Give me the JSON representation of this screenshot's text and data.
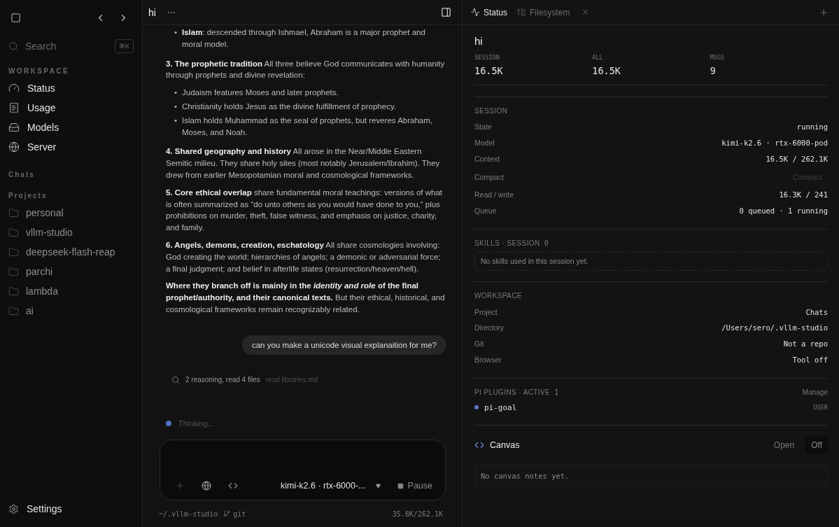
{
  "sidebar": {
    "search": {
      "placeholder": "Search",
      "shortcut": "⌘K"
    },
    "workspace_label": "WORKSPACE",
    "nav": [
      {
        "label": "Status",
        "kind": "status"
      },
      {
        "label": "Usage",
        "kind": "usage"
      },
      {
        "label": "Models",
        "kind": "models"
      },
      {
        "label": "Server",
        "kind": "server"
      }
    ],
    "chats_label": "Chats",
    "projects_label": "Projects",
    "projects": [
      "personal",
      "vllm-studio",
      "deepseek-flash-reap",
      "parchi",
      "lambda",
      "ai"
    ],
    "settings": "Settings"
  },
  "chat": {
    "title": "hi",
    "blocks": [
      {
        "kind": "list",
        "marker": "•",
        "items": [
          "**Islam**: descended through Ishmael, Abraham is a major prophet and moral model."
        ]
      },
      {
        "kind": "para",
        "text": "**3. The prophetic tradition** All three believe God communicates with humanity through prophets and divine revelation:"
      },
      {
        "kind": "list",
        "marker": "•",
        "items": [
          "Judaism features Moses and later prophets.",
          "Christianity holds Jesus as the divine fulfillment of prophecy.",
          "Islam holds Muhammad as the seal of prophets, but reveres Abraham, Moses, and Noah."
        ]
      },
      {
        "kind": "para",
        "text": "**4. Shared geography and history** All arose in the Near/Middle Eastern Semitic milieu. They share holy sites (most notably Jerusalem/Ibrahim). They drew from earlier Mesopotamian moral and cosmological frameworks."
      },
      {
        "kind": "para",
        "text": "**5. Core ethical overlap** share fundamental moral teachings: versions of what is often summarized as “do unto others as you would have done to you,” plus prohibitions on murder, theft, false witness, and emphasis on justice, charity, and family."
      },
      {
        "kind": "para",
        "text": "**6. Angels, demons, creation, eschatology** All share cosmologies involving: God creating the world; hierarchies of angels; a demonic or adversarial force; a final judgment; and belief in afterlife states (resurrection/heaven/hell)."
      },
      {
        "kind": "para",
        "text": "**Where they branch off is mainly in the *identity and role* of the final prophet/authority, and their canonical texts.** But their ethical, historical, and cosmological frameworks remain recognizably related."
      }
    ],
    "user_message": "can you make a unicode visual explanaition for me?",
    "activity": {
      "summary": "2 reasoning, read 4 files",
      "detail": "read libraries.md"
    },
    "status": {
      "text": "Thinking...",
      "color": "#4f6fc4"
    },
    "composer": {
      "model": "kimi-k2.6 · rtx-6000-...",
      "pause": "Pause"
    },
    "footer": {
      "path": "~/.vllm-studio",
      "branch": "git",
      "tokens": "35.8K/262.1K"
    }
  },
  "panel": {
    "tabs": [
      {
        "label": "Status",
        "selected": true,
        "kind": "status",
        "closable": false
      },
      {
        "label": "Filesystem",
        "selected": false,
        "kind": "files",
        "closable": true
      }
    ],
    "title": "hi",
    "stats": [
      {
        "label": "SESSION",
        "value": "16.5K"
      },
      {
        "label": "ALL",
        "value": "16.5K"
      },
      {
        "label": "MSGS",
        "value": "9"
      }
    ],
    "session": {
      "heading": "SESSION",
      "rows": [
        {
          "label": "State",
          "value": "running",
          "kind": "text"
        },
        {
          "label": "Model",
          "value": "kimi-k2.6 · rtx-6000-pod",
          "kind": "text"
        },
        {
          "label": "Context",
          "value": "16.5K / 262.1K",
          "kind": "text"
        },
        {
          "label": "Compact",
          "value": "Compact",
          "kind": "button",
          "disabled": true
        },
        {
          "label": "Read / write",
          "value": "16.3K / 241",
          "kind": "text"
        },
        {
          "label": "Queue",
          "value": "0 queued · 1 running",
          "kind": "text"
        }
      ]
    },
    "skills": {
      "heading": "SKILLS · SESSION",
      "count": "0",
      "empty": "No skills used in this session yet."
    },
    "workspace": {
      "heading": "WORKSPACE",
      "rows": [
        {
          "label": "Project",
          "value": "Chats"
        },
        {
          "label": "Directory",
          "value": "/Users/sero/.vllm-studio"
        },
        {
          "label": "Git",
          "value": "Not a repo"
        },
        {
          "label": "Browser",
          "value": "Tool off"
        }
      ]
    },
    "plugins": {
      "heading": "PI PLUGINS · ACTIVE",
      "count": "1",
      "manage": "Manage",
      "items": [
        {
          "name": "pi-goal",
          "scope": "USER",
          "color": "#5b76c9"
        }
      ]
    },
    "canvas": {
      "title": "Canvas",
      "open": "Open",
      "toggle": "Off",
      "empty": "No canvas notes yet."
    }
  }
}
